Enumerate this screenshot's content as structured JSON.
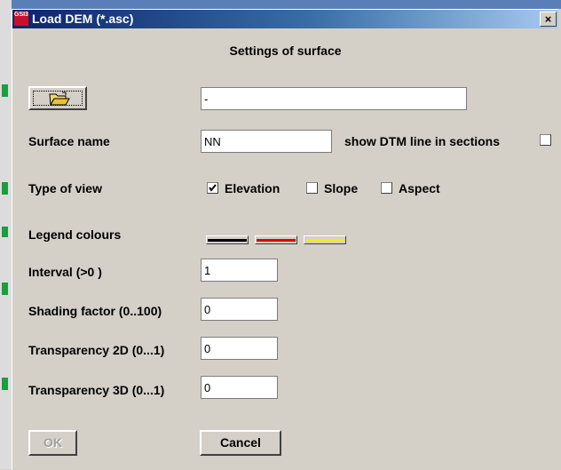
{
  "window": {
    "title": "Load DEM (*.asc)",
    "icon_text": "GSI3D",
    "close_glyph": "×"
  },
  "heading": "Settings of surface",
  "file_path": {
    "value": "-"
  },
  "surface_name": {
    "label": "Surface name",
    "value": "NN"
  },
  "show_dtm": {
    "label": "show DTM line in sections",
    "checked": false
  },
  "type_of_view": {
    "label": "Type of view",
    "options": [
      {
        "label": "Elevation",
        "checked": true
      },
      {
        "label": "Slope",
        "checked": false
      },
      {
        "label": "Aspect",
        "checked": false
      }
    ]
  },
  "legend": {
    "label": "Legend colours",
    "colors": [
      "#000000",
      "#e00000",
      "#f0f000"
    ]
  },
  "interval": {
    "label": "Interval (>0 )",
    "value": "1"
  },
  "shading": {
    "label": "Shading factor (0..100)",
    "value": "0"
  },
  "transparency_2d": {
    "label": "Transparency 2D (0...1)",
    "value": "0"
  },
  "transparency_3d": {
    "label": "Transparency 3D (0...1)",
    "value": "0"
  },
  "buttons": {
    "ok": "OK",
    "cancel": "Cancel"
  }
}
